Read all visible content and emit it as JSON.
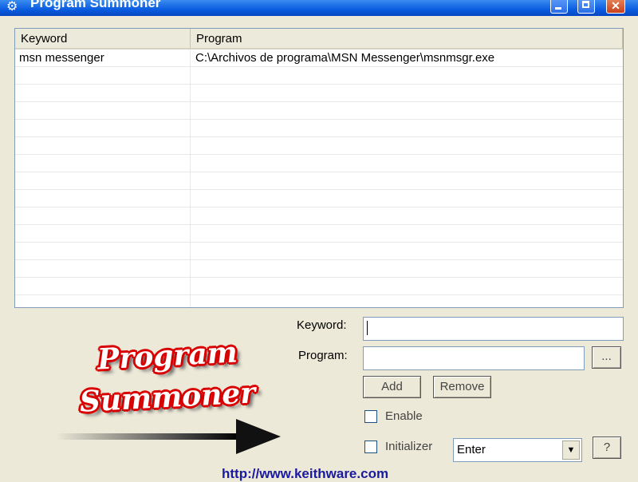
{
  "window": {
    "title": "Program Summoner"
  },
  "list": {
    "columns": [
      "Keyword",
      "Program"
    ],
    "rows": [
      {
        "keyword": "msn messenger",
        "program": "C:\\Archivos de programa\\MSN Messenger\\msnmsgr.exe"
      }
    ]
  },
  "form": {
    "keyword_label": "Keyword:",
    "keyword_value": "",
    "program_label": "Program:",
    "program_value": "",
    "browse_label": "...",
    "add_label": "Add",
    "remove_label": "Remove",
    "enable_label": "Enable",
    "enable_checked": false,
    "initializer_label": "Initializer",
    "initializer_checked": false,
    "initializer_value": "Enter",
    "help_label": "?"
  },
  "branding": {
    "logo_line1": "Program",
    "logo_line2": "Summoner",
    "url": "http://www.keithware.com"
  }
}
